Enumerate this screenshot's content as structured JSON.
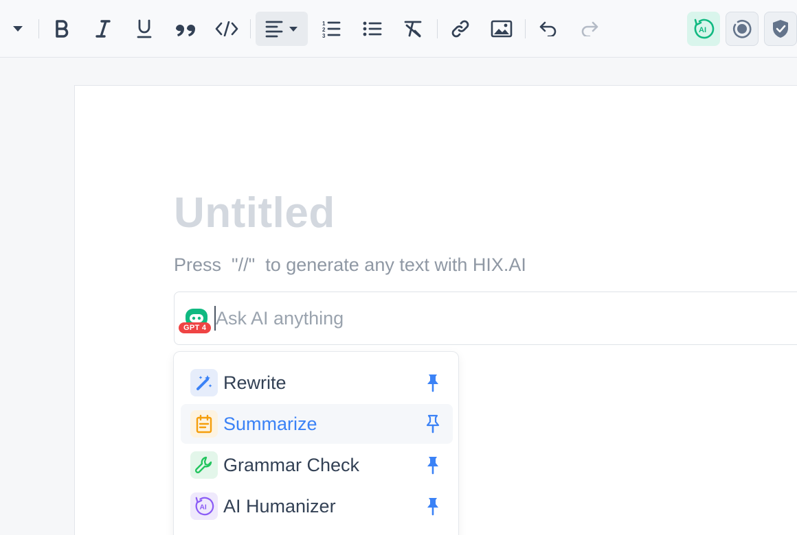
{
  "toolbar": {
    "items": [
      "dropdown",
      "bold",
      "italic",
      "underline",
      "blockquote",
      "code",
      "align-left",
      "ordered-list",
      "bullet-list",
      "clear-format",
      "link",
      "image",
      "undo",
      "redo"
    ],
    "right": [
      "ai-detector",
      "plagiarism-check",
      "security"
    ],
    "colors": {
      "icon": "#334155",
      "muted": "#9aa3ae",
      "accent": "#10b981"
    }
  },
  "document": {
    "title_placeholder": "Untitled",
    "hint": "Press  \"//\"  to generate any text with HIX.AI"
  },
  "ask": {
    "placeholder": "Ask AI anything",
    "model_badge": "GPT 4"
  },
  "menu": {
    "items": [
      {
        "label": "Rewrite",
        "icon": "magic-wand-icon"
      },
      {
        "label": "Summarize",
        "icon": "notepad-icon"
      },
      {
        "label": "Grammar Check",
        "icon": "wrench-icon"
      },
      {
        "label": "AI Humanizer",
        "icon": "ai-humanizer-icon"
      }
    ]
  }
}
